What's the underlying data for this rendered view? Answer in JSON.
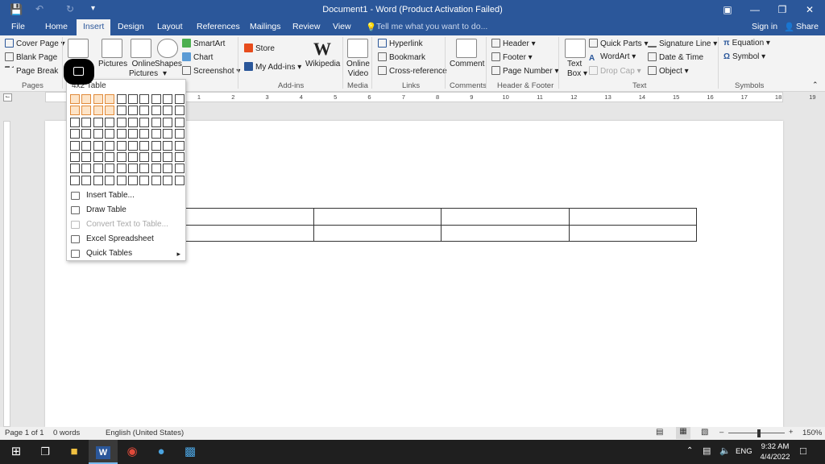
{
  "window": {
    "title": "Document1 - Word (Product Activation Failed)"
  },
  "tabs": [
    "File",
    "Home",
    "Insert",
    "Design",
    "Layout",
    "References",
    "Mailings",
    "Review",
    "View"
  ],
  "tellme": "Tell me what you want to do...",
  "account": {
    "signin": "Sign in",
    "share": "Share"
  },
  "ribbon": {
    "pages": {
      "label": "Pages",
      "cover": "Cover Page",
      "blank": "Blank Page",
      "break": "Page Break"
    },
    "illus": {
      "pictures": "Pictures",
      "online1": "Online",
      "online2": "Pictures",
      "shapes": "Shapes",
      "smartart": "SmartArt",
      "chart": "Chart",
      "screenshot": "Screenshot"
    },
    "addins": {
      "label": "Add-ins",
      "store": "Store",
      "myaddins": "My Add-ins",
      "wikipedia": "Wikipedia"
    },
    "media": {
      "label": "Media",
      "v1": "Online",
      "v2": "Video"
    },
    "links": {
      "label": "Links",
      "hyperlink": "Hyperlink",
      "bookmark": "Bookmark",
      "crossref": "Cross-reference"
    },
    "comments": {
      "label": "Comments",
      "comment": "Comment"
    },
    "hf": {
      "label": "Header & Footer",
      "header": "Header",
      "footer": "Footer",
      "pagenumber": "Page Number"
    },
    "text": {
      "label": "Text",
      "tb1": "Text",
      "tb2": "Box",
      "quickparts": "Quick Parts",
      "wordart": "WordArt",
      "dropcap": "Drop Cap",
      "sigline": "Signature Line",
      "datetime": "Date & Time",
      "object": "Object"
    },
    "symbols": {
      "label": "Symbols",
      "equation": "Equation",
      "symbol": "Symbol"
    }
  },
  "table_menu": {
    "title": "4x2 Table",
    "rows": 8,
    "cols": 10,
    "highlight_rows": 2,
    "highlight_cols": 4,
    "items": [
      {
        "label": "Insert Table...",
        "enabled": true
      },
      {
        "label": "Draw Table",
        "enabled": true
      },
      {
        "label": "Convert Text to Table...",
        "enabled": false
      },
      {
        "label": "Excel Spreadsheet",
        "enabled": true
      },
      {
        "label": "Quick Tables",
        "enabled": true
      }
    ]
  },
  "ruler": [
    "1",
    "2",
    "3",
    "4",
    "5",
    "6",
    "7",
    "8",
    "9",
    "10",
    "11",
    "12",
    "13",
    "14",
    "15",
    "16",
    "17",
    "18",
    "19"
  ],
  "doc_table": {
    "rows": 2,
    "cols": 4
  },
  "status": {
    "page": "Page 1 of 1",
    "words": "0 words",
    "lang": "English (United States)",
    "zoom": "150%"
  },
  "taskbar": {
    "lang": "ENG",
    "time": "9:32 AM",
    "date": "4/4/2022"
  }
}
